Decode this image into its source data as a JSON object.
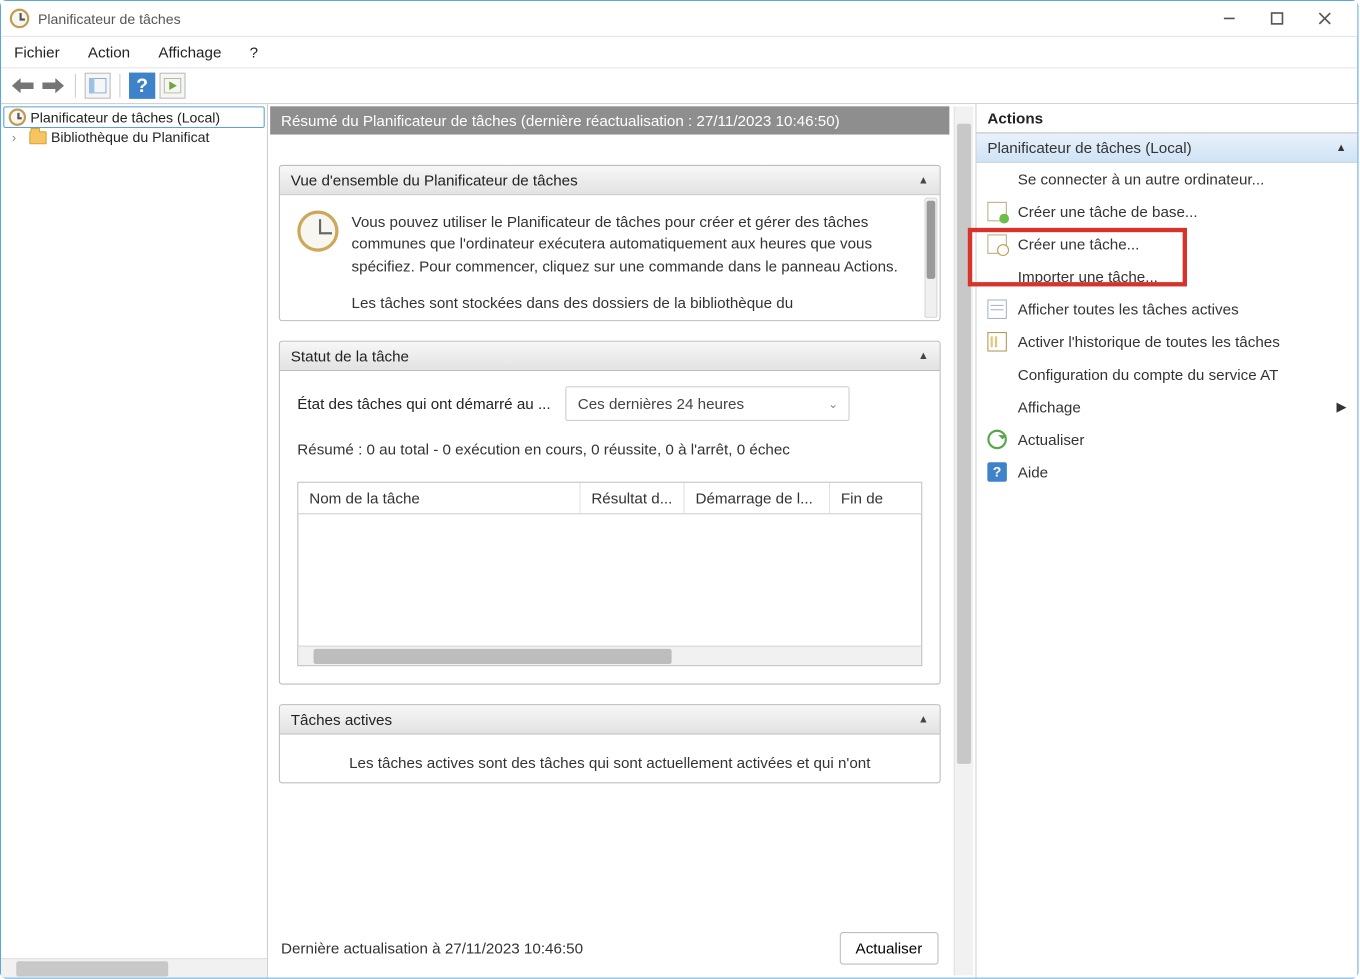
{
  "window": {
    "title": "Planificateur de tâches"
  },
  "menu": {
    "file": "Fichier",
    "action": "Action",
    "view": "Affichage",
    "help": "?"
  },
  "tree": {
    "root": "Planificateur de tâches (Local)",
    "library": "Bibliothèque du Planificat"
  },
  "banner": "Résumé du Planificateur de tâches (dernière réactualisation : 27/11/2023 10:46:50)",
  "overview": {
    "title": "Vue d'ensemble du Planificateur de tâches",
    "text1": "Vous pouvez utiliser le Planificateur de tâches pour créer et gérer des tâches communes que l'ordinateur exécutera automatiquement aux heures que vous spécifiez. Pour commencer, cliquez sur une commande dans le panneau Actions.",
    "text2": "Les tâches sont stockées dans des dossiers de la bibliothèque du"
  },
  "status": {
    "title": "Statut de la tâche",
    "state_label": "État des tâches qui ont démarré au ...",
    "combo": "Ces dernières 24 heures",
    "summary": "Résumé : 0 au total - 0 exécution en cours, 0 réussite, 0 à l'arrêt, 0 échec",
    "cols": {
      "name": "Nom de la tâche",
      "result": "Résultat d...",
      "start": "Démarrage de l...",
      "end": "Fin de"
    }
  },
  "active": {
    "title": "Tâches actives",
    "text": "Les tâches actives sont des tâches qui sont actuellement activées et qui n'ont"
  },
  "footer": {
    "last_refresh": "Dernière actualisation à 27/11/2023 10:46:50",
    "refresh_btn": "Actualiser"
  },
  "actions": {
    "title": "Actions",
    "subtitle": "Planificateur de tâches (Local)",
    "items": {
      "connect": "Se connecter à un autre ordinateur...",
      "create_basic": "Créer une tâche de base...",
      "create": "Créer une tâche...",
      "import": "Importer une tâche...",
      "show_all": "Afficher toutes les tâches actives",
      "enable_history": "Activer l'historique de toutes les tâches",
      "at_config": "Configuration du compte du service AT",
      "view": "Affichage",
      "refresh": "Actualiser",
      "help": "Aide"
    }
  }
}
